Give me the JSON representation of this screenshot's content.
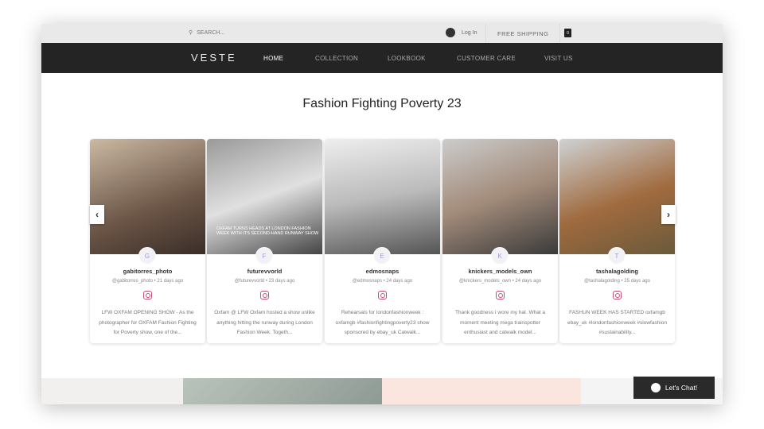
{
  "topbar": {
    "search_placeholder": "SEARCH...",
    "login": "Log In",
    "shipping": "FREE SHIPPING",
    "cart_count": "0"
  },
  "nav": {
    "logo": "VESTE",
    "items": [
      "HOME",
      "COLLECTION",
      "LOOKBOOK",
      "CUSTOMER CARE",
      "VISIT US"
    ]
  },
  "title": "Fashion Fighting Poverty 23",
  "posts": [
    {
      "initial": "G",
      "name": "gabitorres_photo",
      "handle": "@gabitorres_photo",
      "age": "21 days ago",
      "text": "LFW OXFAM OPENING SHOW - As the photographer for OXFAM Fashion Fighting for Poverty show, one of the..."
    },
    {
      "initial": "F",
      "name": "futurevvorld",
      "handle": "@futurevvorld",
      "age": "23 days ago",
      "text": "Oxfam @ LFW Oxfam hosted a show unlike anything hitting the runway during London Fashion Week. Togeth...",
      "overlay": "OXFAM TURNS HEADS AT LONDON FASHION WEEK WITH ITS SECOND-HAND RUNWAY SHOW"
    },
    {
      "initial": "E",
      "name": "edmosnaps",
      "handle": "@edmosnaps",
      "age": "24 days ago",
      "text": "Rehearsals for londonfashionweek : oxfamgb #fashionfightingpoverty23 show sponsored by ebay_uk Catwalk..."
    },
    {
      "initial": "K",
      "name": "knickers_models_own",
      "handle": "@knickers_models_own",
      "age": "24 days ago",
      "text": "Thank goodness I wore my hat. What a moment meeting mega trainspotter enthusiast and catwalk model..."
    },
    {
      "initial": "T",
      "name": "tashalagolding",
      "handle": "@tashalagolding",
      "age": "25 days ago",
      "text": "FASHUN WEEK HAS STARTED oxfamgb ebay_uk #londonfashionweek #slowfashion #sustainability..."
    }
  ],
  "chat": {
    "label": "Let's Chat!"
  }
}
